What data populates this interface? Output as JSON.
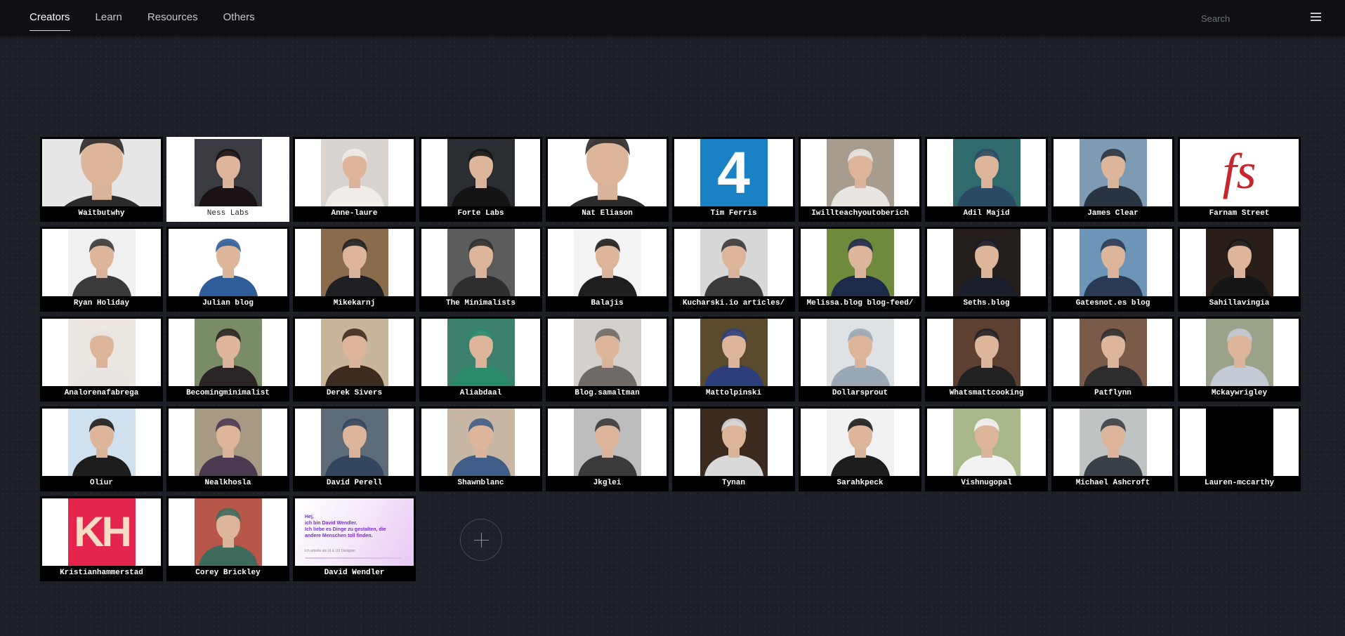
{
  "nav": {
    "items": [
      {
        "label": "Creators",
        "active": true
      },
      {
        "label": "Learn",
        "active": false
      },
      {
        "label": "Resources",
        "active": false
      },
      {
        "label": "Others",
        "active": false
      }
    ],
    "search_placeholder": "Search"
  },
  "creators": [
    {
      "label": "Waitbutwhy",
      "thumb": "photo",
      "bg": "#e6e6e6",
      "fg": "#2a2a2a",
      "full": true
    },
    {
      "label": "Ness Labs",
      "thumb": "photo",
      "bg": "#3a3b40",
      "fg": "#1a1214",
      "selected": true
    },
    {
      "label": "Anne-laure",
      "thumb": "photo",
      "bg": "#d9d4cf",
      "fg": "#f0ece8"
    },
    {
      "label": "Forte Labs",
      "thumb": "photo",
      "bg": "#2a2e33",
      "fg": "#141414"
    },
    {
      "label": "Nat Eliason",
      "thumb": "photo",
      "bg": "#ffffff",
      "fg": "#2b2b2b",
      "full": true
    },
    {
      "label": "Tim Ferris",
      "thumb": "number",
      "bg": "#1a82c4",
      "text": "4"
    },
    {
      "label": "Iwillteachyoutoberich",
      "thumb": "photo",
      "bg": "#a89c8e",
      "fg": "#e8e4df"
    },
    {
      "label": "Adil Majid",
      "thumb": "photo",
      "bg": "#2f6a6d",
      "fg": "#2a4a63"
    },
    {
      "label": "James Clear",
      "thumb": "photo",
      "bg": "#7f9bb3",
      "fg": "#2a3440"
    },
    {
      "label": "Farnam Street",
      "thumb": "logo-fs",
      "bg": "#ffffff",
      "text": "fs"
    },
    {
      "label": "Ryan Holiday",
      "thumb": "photo",
      "bg": "#f0f0f0",
      "fg": "#3a3a3a"
    },
    {
      "label": "Julian blog",
      "thumb": "photo",
      "bg": "#ffffff",
      "fg": "#2f5d9a"
    },
    {
      "label": "Mikekarnj",
      "thumb": "photo",
      "bg": "#8a6b4b",
      "fg": "#1f2024"
    },
    {
      "label": "The Minimalists",
      "thumb": "photo",
      "bg": "#5c5c5c",
      "fg": "#2e2e2e"
    },
    {
      "label": "Balajis",
      "thumb": "photo",
      "bg": "#f4f4f4",
      "fg": "#1e1e1e"
    },
    {
      "label": "Kucharski.io articles/",
      "thumb": "photo",
      "bg": "#d8d8d8",
      "fg": "#3a3a3a"
    },
    {
      "label": "Melissa.blog blog-feed/",
      "thumb": "photo",
      "bg": "#6f8a3c",
      "fg": "#1d2a4a"
    },
    {
      "label": "Seths.blog",
      "thumb": "photo",
      "bg": "#241f1c",
      "fg": "#1a1d2a"
    },
    {
      "label": "Gatesnot.es blog",
      "thumb": "photo",
      "bg": "#6c95b8",
      "fg": "#2a3a55"
    },
    {
      "label": "Sahillavingia",
      "thumb": "photo",
      "bg": "#2a1e18",
      "fg": "#161616"
    },
    {
      "label": "Analorenafabrega",
      "thumb": "photo",
      "bg": "#ede7e1",
      "fg": "#e9e6e3"
    },
    {
      "label": "Becomingminimalist",
      "thumb": "photo",
      "bg": "#7a8c67",
      "fg": "#2a2424"
    },
    {
      "label": "Derek Sivers",
      "thumb": "photo",
      "bg": "#c9b59b",
      "fg": "#3c2b20"
    },
    {
      "label": "Aliabdaal",
      "thumb": "photo",
      "bg": "#3c7f6d",
      "fg": "#2a8a6a"
    },
    {
      "label": "Blog.samaltman",
      "thumb": "photo",
      "bg": "#d4d0cc",
      "fg": "#6f6a66"
    },
    {
      "label": "Mattolpinski",
      "thumb": "photo",
      "bg": "#5a4a2e",
      "fg": "#2d3f7a"
    },
    {
      "label": "Dollarsprout",
      "thumb": "photo",
      "bg": "#dfe2e4",
      "fg": "#9aa8b6"
    },
    {
      "label": "Whatsmattcooking",
      "thumb": "photo",
      "bg": "#5d4032",
      "fg": "#222222"
    },
    {
      "label": "Patflynn",
      "thumb": "photo",
      "bg": "#7a5a48",
      "fg": "#2d2d2d"
    },
    {
      "label": "Mckaywrigley",
      "thumb": "photo",
      "bg": "#9ba28a",
      "fg": "#c5cbd6"
    },
    {
      "label": "Oliur",
      "thumb": "photo",
      "bg": "#cfe0ee",
      "fg": "#1d1d1d"
    },
    {
      "label": "Nealkhosla",
      "thumb": "photo",
      "bg": "#a69a84",
      "fg": "#4a3a52"
    },
    {
      "label": "David Perell",
      "thumb": "photo",
      "bg": "#5e6c7a",
      "fg": "#33465e"
    },
    {
      "label": "Shawnblanc",
      "thumb": "photo",
      "bg": "#c7b7a4",
      "fg": "#3f5d86"
    },
    {
      "label": "Jkglei",
      "thumb": "photo",
      "bg": "#bdbdbd",
      "fg": "#3a3a3a"
    },
    {
      "label": "Tynan",
      "thumb": "photo",
      "bg": "#3a2b1e",
      "fg": "#d9d9d9"
    },
    {
      "label": "Sarahkpeck",
      "thumb": "photo",
      "bg": "#f2f2f2",
      "fg": "#1d1d1d"
    },
    {
      "label": "Vishnugopal",
      "thumb": "photo",
      "bg": "#a9b88b",
      "fg": "#f2f2f2"
    },
    {
      "label": "Michael Ashcroft",
      "thumb": "photo",
      "bg": "#bfc3c4",
      "fg": "#3a4047"
    },
    {
      "label": "Lauren-mccarthy",
      "thumb": "blank",
      "bg": "#000000"
    },
    {
      "label": "Kristianhammerstad",
      "thumb": "logo-kh",
      "bg": "#e4254d",
      "text": "KH"
    },
    {
      "label": "Corey Brickley",
      "thumb": "photo",
      "bg": "#b7574a",
      "fg": "#3f6b5c"
    },
    {
      "label": "David Wendler",
      "thumb": "web",
      "bg": "#f4e9fa",
      "text_lines": [
        "Hej,",
        "ich bin David Wendler.",
        "Ich liebe es Dinge zu gestalten, die",
        "andere Menschen toll finden."
      ],
      "subtext": "Ich arbeite als UI & UX Designer."
    }
  ]
}
